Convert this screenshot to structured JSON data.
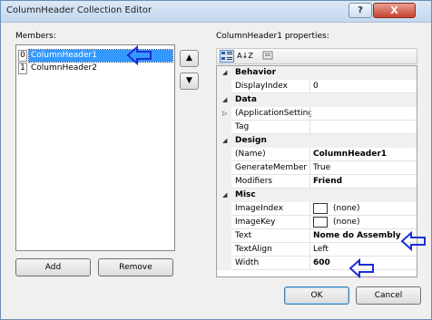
{
  "window": {
    "title": "ColumnHeader Collection Editor",
    "help_glyph": "?",
    "close_glyph": "X"
  },
  "members": {
    "label": "Members:",
    "items": [
      {
        "index": "0",
        "name": "ColumnHeader1",
        "selected": true
      },
      {
        "index": "1",
        "name": "ColumnHeader2",
        "selected": false
      }
    ],
    "move_up_icon": "▲",
    "move_down_icon": "▼",
    "add_label": "Add",
    "remove_label": "Remove"
  },
  "properties": {
    "label": "ColumnHeader1 properties:",
    "toolbar": {
      "categorized_icon": "categorized-icon",
      "alphabetical_icon": "alphabetical-icon",
      "alphabetical_text": "A↓Z",
      "property_pages_icon": "property-pages-icon"
    },
    "rows": [
      {
        "type": "category",
        "name": "Behavior"
      },
      {
        "type": "prop",
        "name": "DisplayIndex",
        "value": "0"
      },
      {
        "type": "category",
        "name": "Data"
      },
      {
        "type": "prop",
        "name": "(ApplicationSetting:",
        "value": "",
        "expandable": true
      },
      {
        "type": "prop",
        "name": "Tag",
        "value": ""
      },
      {
        "type": "category",
        "name": "Design"
      },
      {
        "type": "prop",
        "name": "(Name)",
        "value": "ColumnHeader1",
        "bold": true
      },
      {
        "type": "prop",
        "name": "GenerateMember",
        "value": "True"
      },
      {
        "type": "prop",
        "name": "Modifiers",
        "value": "Friend",
        "bold": true
      },
      {
        "type": "category",
        "name": "Misc"
      },
      {
        "type": "prop",
        "name": "ImageIndex",
        "value": "(none)",
        "swatch": true
      },
      {
        "type": "prop",
        "name": "ImageKey",
        "value": "(none)",
        "swatch": true
      },
      {
        "type": "prop",
        "name": "Text",
        "value": "Nome do Assembly",
        "bold": true
      },
      {
        "type": "prop",
        "name": "TextAlign",
        "value": "Left"
      },
      {
        "type": "prop",
        "name": "Width",
        "value": "600",
        "bold": true
      }
    ]
  },
  "footer": {
    "ok_label": "OK",
    "cancel_label": "Cancel"
  },
  "colors": {
    "selection": "#3399ff",
    "callout_arrow": "#1a2fd6"
  }
}
